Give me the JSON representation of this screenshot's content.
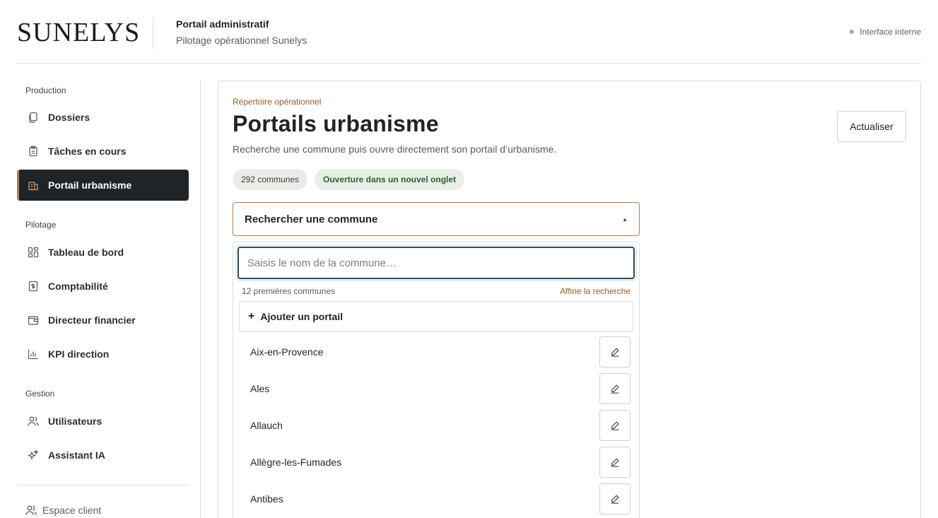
{
  "brand": {
    "logo": "SUNELYS"
  },
  "header": {
    "title": "Portail administratif",
    "subtitle": "Pilotage opérationnel Sunelys",
    "status": "Interface interne"
  },
  "sidebar": {
    "sections": [
      {
        "label": "Production"
      },
      {
        "label": "Pilotage"
      },
      {
        "label": "Gestion"
      }
    ],
    "items": [
      {
        "label": "Dossiers",
        "icon": "documents-icon"
      },
      {
        "label": "Tâches en cours",
        "icon": "clipboard-icon"
      },
      {
        "label": "Portail urbanisme",
        "icon": "building-icon",
        "active": true
      },
      {
        "label": "Tableau de bord",
        "icon": "dashboard-icon"
      },
      {
        "label": "Comptabilité",
        "icon": "receipt-icon"
      },
      {
        "label": "Directeur financier",
        "icon": "wallet-icon"
      },
      {
        "label": "KPI direction",
        "icon": "bar-chart-icon"
      },
      {
        "label": "Utilisateurs",
        "icon": "users-icon"
      },
      {
        "label": "Assistant IA",
        "icon": "sparkle-icon"
      }
    ],
    "client": {
      "label": "Espace client",
      "icon": "users-icon"
    }
  },
  "main": {
    "eyebrow": "Répertoire opérationnel",
    "title": "Portails urbanisme",
    "description": "Recherche une commune puis ouvre directement son portail d’urbanisme.",
    "refresh_label": "Actualiser",
    "chips": {
      "count": "292 communes",
      "new_tab": "Ouverture dans un nouvel onglet"
    },
    "select_label": "Rechercher une commune",
    "search": {
      "placeholder": "Saisis le nom de la commune…",
      "value": ""
    },
    "meta_left": "12 premières communes",
    "meta_right": "Affine la recherche",
    "add_portal_label": "Ajouter un portail",
    "communes": [
      "Aix-en-Provence",
      "Ales",
      "Allauch",
      "Allègre-les-Fumades",
      "Antibes"
    ]
  },
  "colors": {
    "accent": "#b47a4f",
    "dark": "#1f2428",
    "chip_green_bg": "#e7efe6",
    "chip_green_text": "#2f5e34"
  }
}
